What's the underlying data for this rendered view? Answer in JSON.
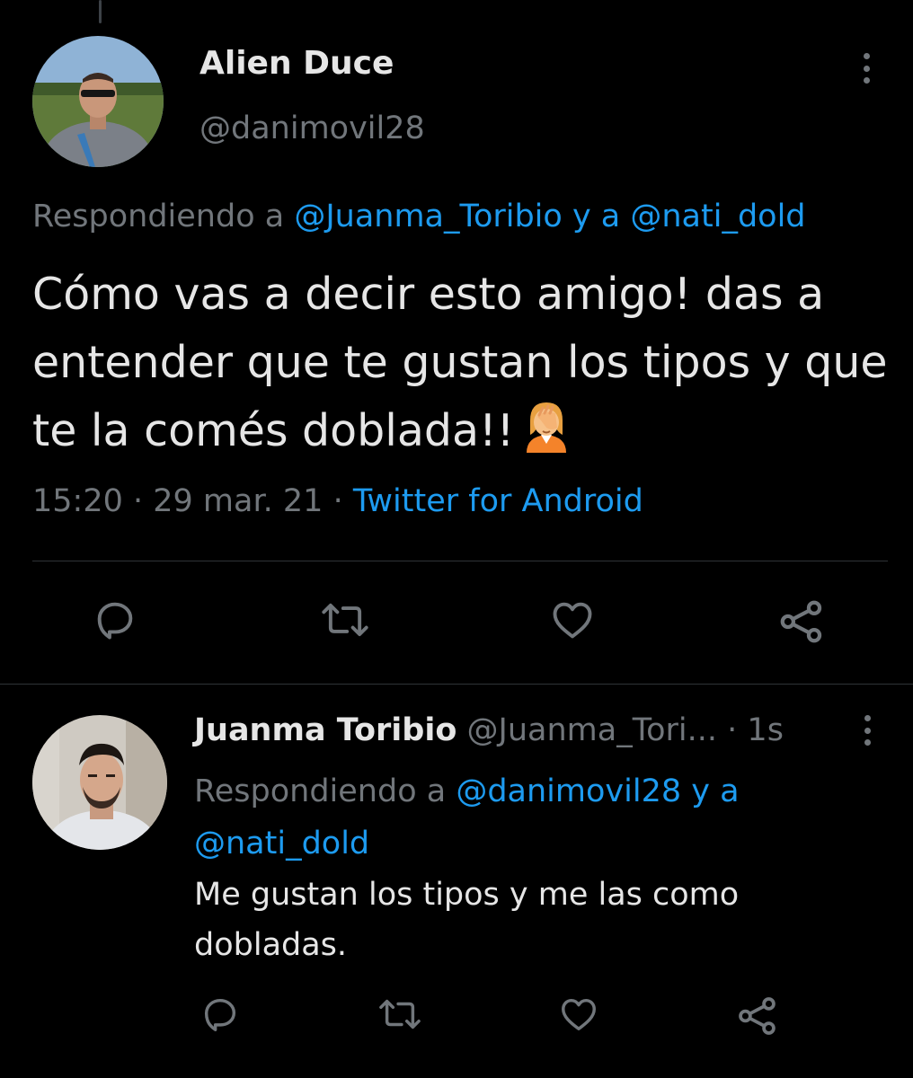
{
  "main_tweet": {
    "author_name": "Alien Duce",
    "author_handle": "@danimovil28",
    "replying_prefix": "Respondiendo a ",
    "replying_to_1": "@Juanma_Toribio",
    "replying_joiner": " y a ",
    "replying_to_2": "@nati_dold",
    "text": "Cómo vas a decir esto amigo! das a entender que te gustan los tipos y que te la comés doblada!!",
    "emoji": "face-palm",
    "time": "15:20",
    "sep1": " · ",
    "date": "29 mar. 21",
    "sep2": " · ",
    "source": "Twitter for Android"
  },
  "reply_tweet": {
    "author_name": "Juanma Toribio",
    "author_handle": "@Juanma_Tori...",
    "separator": " · ",
    "time": "1s",
    "replying_prefix": "Respondiendo a ",
    "replying_to_1": "@danimovil28",
    "replying_joiner": " y a",
    "replying_to_2": "@nati_dold",
    "text": "Me gustan los tipos y me las como dobladas."
  },
  "actions": [
    "reply-icon",
    "retweet-icon",
    "like-icon",
    "share-icon"
  ],
  "colors": {
    "background": "#000000",
    "text": "#e6e6e6",
    "secondary": "#71767b",
    "link": "#1d9bf0",
    "divider": "#2f3336"
  }
}
